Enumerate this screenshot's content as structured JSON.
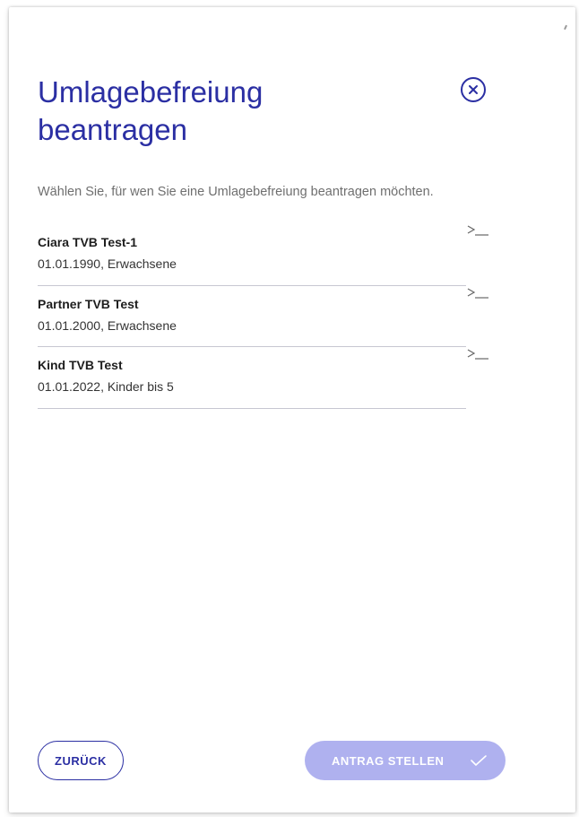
{
  "dialog": {
    "title": "Umlagebefreiung beantragen",
    "instruction": "Wählen Sie, für wen Sie eine Umlagebefreiung beantragen möchten."
  },
  "persons": [
    {
      "name": "Ciara TVB Test-1",
      "detail": "01.01.1990, Erwachsene"
    },
    {
      "name": "Partner TVB Test",
      "detail": "01.01.2000, Erwachsene"
    },
    {
      "name": "Kind TVB Test",
      "detail": "01.01.2022, Kinder bis 5"
    }
  ],
  "footer": {
    "back_label": "ZURÜCK",
    "submit_label": "ANTRAG STELLEN",
    "submit_state": "disabled"
  },
  "icons": {
    "close": "close-circle-icon",
    "row_arrow": "arrow-right-icon",
    "submit": "checkmark-icon"
  },
  "colors": {
    "accent": "#2b2fa3",
    "submit_disabled": "#afb1ef",
    "divider": "#c7c7d1"
  }
}
